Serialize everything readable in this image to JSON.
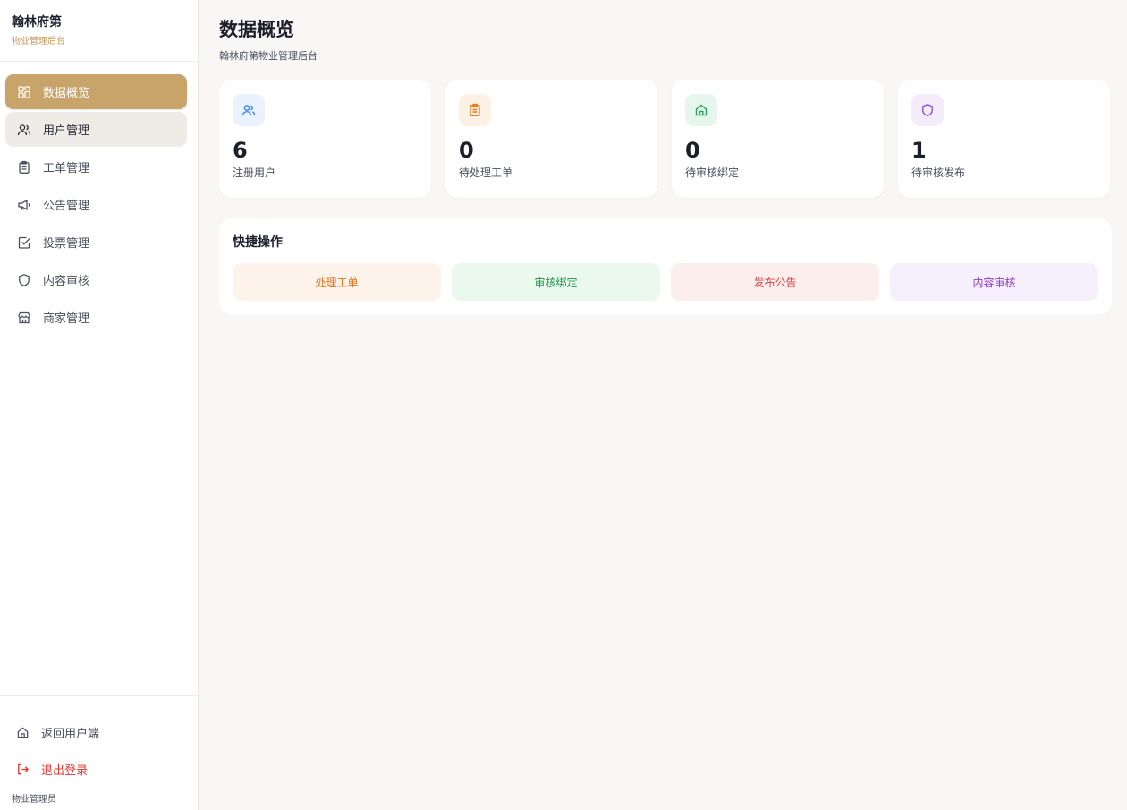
{
  "brand": {
    "name": "翰林府第",
    "subtitle": "物业管理后台"
  },
  "sidebar": {
    "items": [
      {
        "label": "数据概览",
        "icon": "grid-icon",
        "state": "active"
      },
      {
        "label": "用户管理",
        "icon": "users-icon",
        "state": "hover"
      },
      {
        "label": "工单管理",
        "icon": "clipboard-icon",
        "state": "normal"
      },
      {
        "label": "公告管理",
        "icon": "megaphone-icon",
        "state": "normal"
      },
      {
        "label": "投票管理",
        "icon": "checkbox-icon",
        "state": "normal"
      },
      {
        "label": "内容审核",
        "icon": "shield-icon",
        "state": "normal"
      },
      {
        "label": "商家管理",
        "icon": "store-icon",
        "state": "normal"
      }
    ],
    "bottom": {
      "back_label": "返回用户端",
      "logout_label": "退出登录",
      "role": "物业管理员"
    }
  },
  "header": {
    "title": "数据概览",
    "subtitle": "翰林府第物业管理后台"
  },
  "stats": [
    {
      "value": "6",
      "label": "注册用户",
      "icon": "users-icon",
      "color": "#3b82f6",
      "bg": "#eaf2fe"
    },
    {
      "value": "0",
      "label": "待处理工单",
      "icon": "clipboard-icon",
      "color": "#ea7a1a",
      "bg": "#fdf0e4"
    },
    {
      "value": "0",
      "label": "待审核绑定",
      "icon": "home-icon",
      "color": "#22a55a",
      "bg": "#e6f6ec"
    },
    {
      "value": "1",
      "label": "待审核发布",
      "icon": "shield-icon",
      "color": "#9b4dd8",
      "bg": "#f4ecfb"
    }
  ],
  "quick": {
    "title": "快捷操作",
    "buttons": [
      {
        "label": "处理工单",
        "color": "#e2731c",
        "bg": "#fef3ea"
      },
      {
        "label": "审核绑定",
        "color": "#23914a",
        "bg": "#eaf8ee"
      },
      {
        "label": "发布公告",
        "color": "#dc3a3a",
        "bg": "#fdeeee"
      },
      {
        "label": "内容审核",
        "color": "#8e3fc6",
        "bg": "#f6effc"
      }
    ]
  }
}
